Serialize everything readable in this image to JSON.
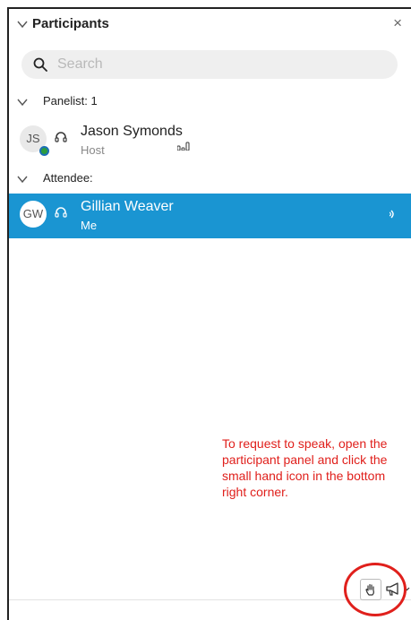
{
  "header": {
    "title": "Participants",
    "close_label": "×"
  },
  "search": {
    "placeholder": "Search"
  },
  "sections": {
    "panelist": "Panelist: 1",
    "attendee": "Attendee:"
  },
  "participants": [
    {
      "initials": "JS",
      "name": "Jason Symonds",
      "role": "Host",
      "selected": false
    },
    {
      "initials": "GW",
      "name": "Gillian Weaver",
      "role": "Me",
      "selected": true
    }
  ],
  "annotation": {
    "text": "To request to speak, open the participant panel and click the small hand icon in the bottom right corner."
  },
  "colors": {
    "selection": "#1a95d2",
    "annotation": "#e0201c",
    "status_green": "#2b9d3f"
  },
  "icons": {
    "collapse": "chevron-down-icon",
    "close": "close-icon",
    "search": "search-icon",
    "headset": "headset-icon",
    "audio_level": "audio-level-icon",
    "speaking": "speaking-icon",
    "raise_hand": "raise-hand-icon",
    "megaphone": "megaphone-icon"
  }
}
